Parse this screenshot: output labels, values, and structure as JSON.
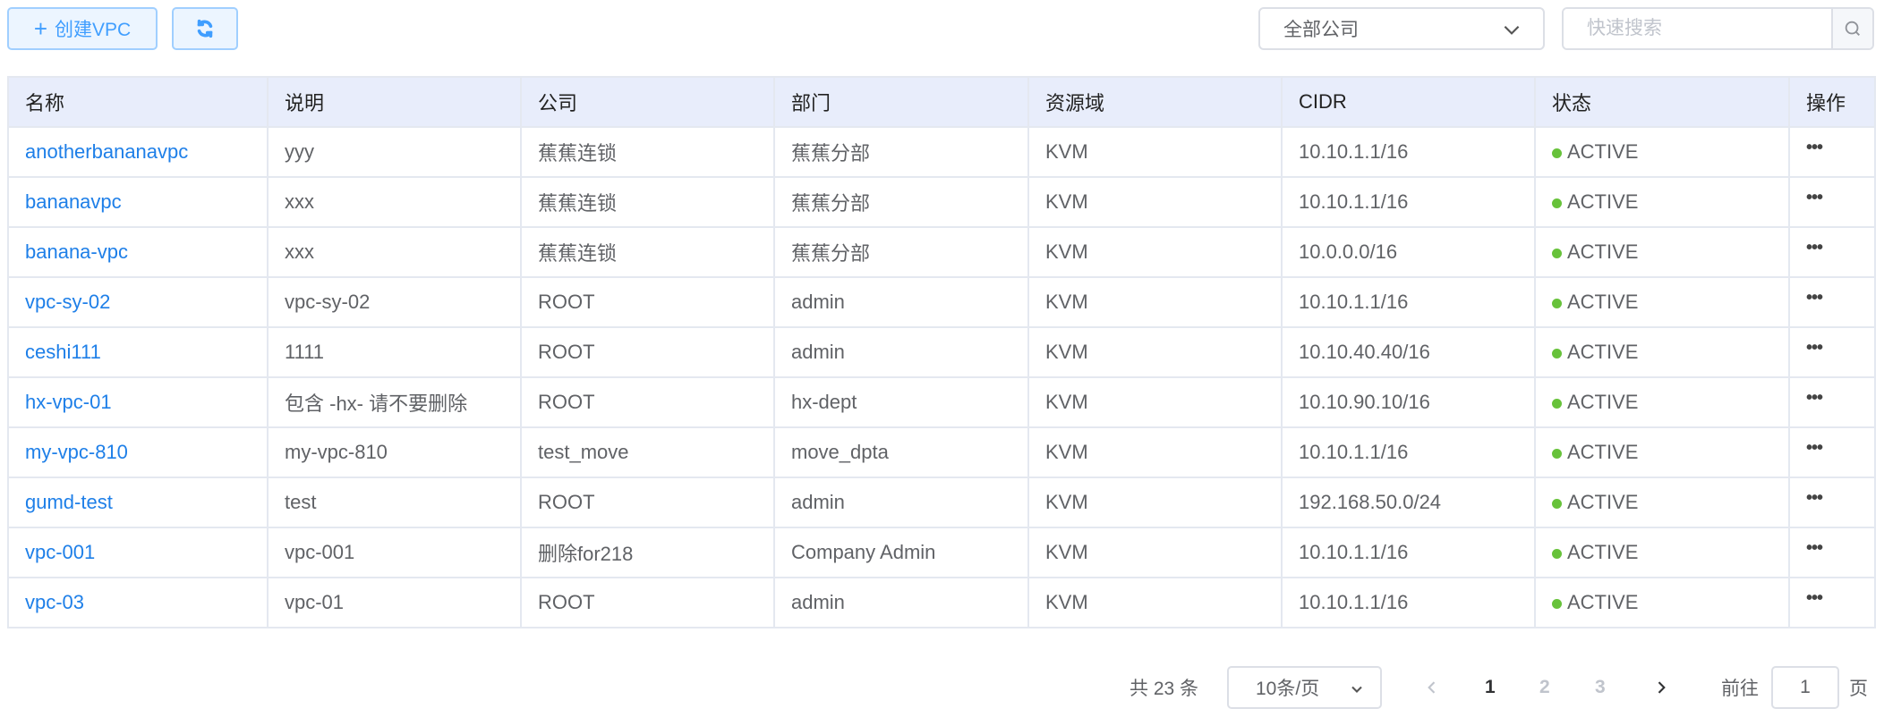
{
  "toolbar": {
    "create_label": "创建VPC",
    "refresh_icon": "refresh-icon"
  },
  "filter": {
    "company_selected": "全部公司",
    "search_placeholder": "快速搜索"
  },
  "table": {
    "columns": [
      "名称",
      "说明",
      "公司",
      "部门",
      "资源域",
      "CIDR",
      "状态",
      "操作"
    ],
    "rows": [
      {
        "name": "anotherbananavpc",
        "desc": "yyy",
        "company": "蕉蕉连锁",
        "dept": "蕉蕉分部",
        "domain": "KVM",
        "cidr": "10.10.1.1/16",
        "status": "ACTIVE"
      },
      {
        "name": "bananavpc",
        "desc": "xxx",
        "company": "蕉蕉连锁",
        "dept": "蕉蕉分部",
        "domain": "KVM",
        "cidr": "10.10.1.1/16",
        "status": "ACTIVE"
      },
      {
        "name": "banana-vpc",
        "desc": "xxx",
        "company": "蕉蕉连锁",
        "dept": "蕉蕉分部",
        "domain": "KVM",
        "cidr": "10.0.0.0/16",
        "status": "ACTIVE"
      },
      {
        "name": "vpc-sy-02",
        "desc": "vpc-sy-02",
        "company": "ROOT",
        "dept": "admin",
        "domain": "KVM",
        "cidr": "10.10.1.1/16",
        "status": "ACTIVE"
      },
      {
        "name": "ceshi111",
        "desc": "1111",
        "company": "ROOT",
        "dept": "admin",
        "domain": "KVM",
        "cidr": "10.10.40.40/16",
        "status": "ACTIVE"
      },
      {
        "name": "hx-vpc-01",
        "desc": "包含 -hx- 请不要删除",
        "company": "ROOT",
        "dept": "hx-dept",
        "domain": "KVM",
        "cidr": "10.10.90.10/16",
        "status": "ACTIVE"
      },
      {
        "name": "my-vpc-810",
        "desc": "my-vpc-810",
        "company": "test_move",
        "dept": "move_dpta",
        "domain": "KVM",
        "cidr": "10.10.1.1/16",
        "status": "ACTIVE"
      },
      {
        "name": "gumd-test",
        "desc": "test",
        "company": "ROOT",
        "dept": "admin",
        "domain": "KVM",
        "cidr": "192.168.50.0/24",
        "status": "ACTIVE"
      },
      {
        "name": "vpc-001",
        "desc": "vpc-001",
        "company": "删除for218",
        "dept": "Company Admin",
        "domain": "KVM",
        "cidr": "10.10.1.1/16",
        "status": "ACTIVE"
      },
      {
        "name": "vpc-03",
        "desc": "vpc-01",
        "company": "ROOT",
        "dept": "admin",
        "domain": "KVM",
        "cidr": "10.10.1.1/16",
        "status": "ACTIVE"
      }
    ],
    "action_label": "•••"
  },
  "pagination": {
    "total_label": "共 23 条",
    "page_size": "10条/页",
    "pages": [
      "1",
      "2",
      "3"
    ],
    "current": "1",
    "goto_label": "前往",
    "goto_value": "1",
    "page_suffix": "页"
  },
  "colors": {
    "accent": "#409eff",
    "link": "#1e7fe8",
    "active": "#67c23a",
    "header_bg": "#e8edfb"
  }
}
